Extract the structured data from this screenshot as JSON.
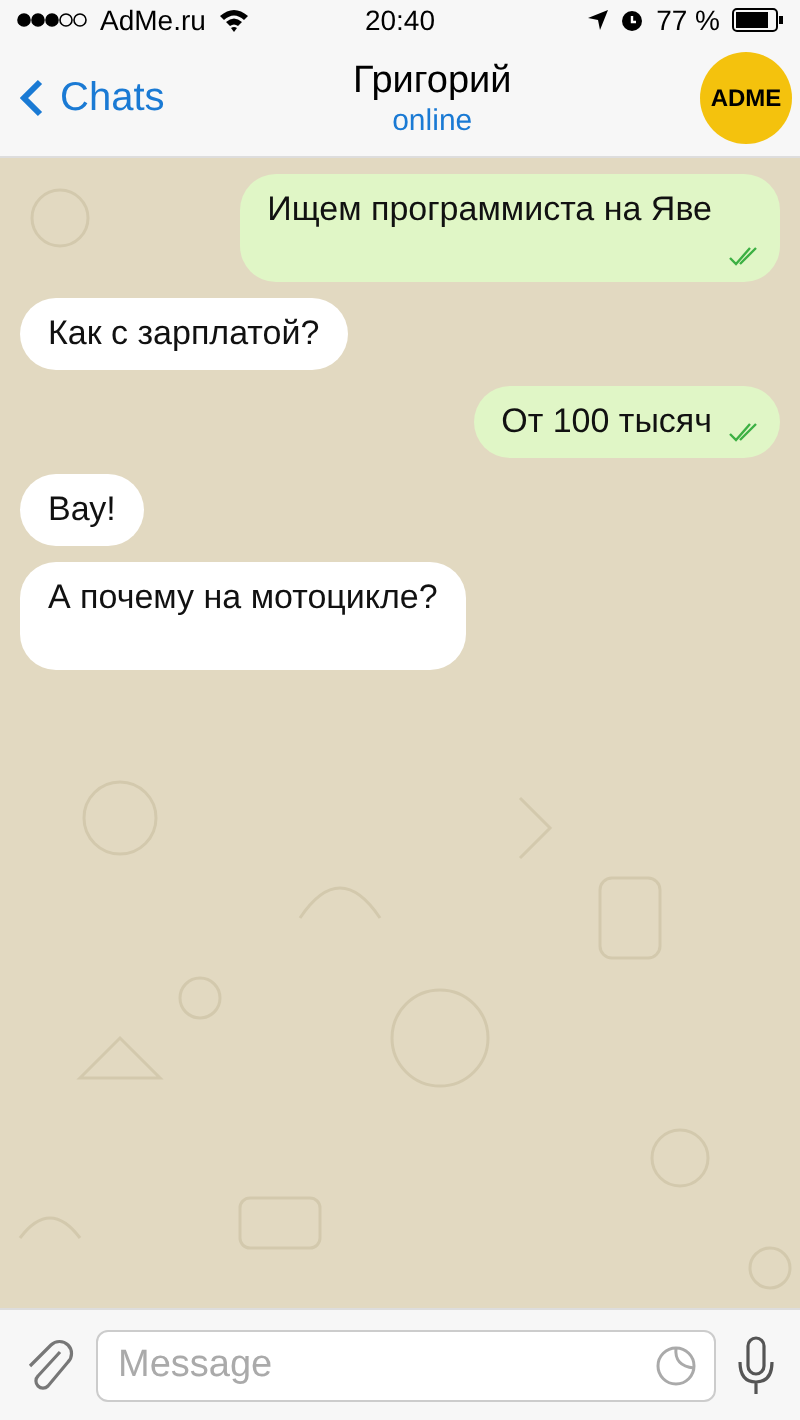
{
  "status_bar": {
    "carrier": "AdMe.ru",
    "time": "20:40",
    "battery": "77 %"
  },
  "header": {
    "back": "Chats",
    "title": "Григорий",
    "subtitle": "online",
    "avatar": "ADME"
  },
  "messages": [
    {
      "kind": "out",
      "text": "Ищем программиста на Яве",
      "read": true,
      "tall": true
    },
    {
      "kind": "in",
      "text": "Как с зарплатой?",
      "tall": false
    },
    {
      "kind": "out",
      "text": "От 100 тысяч",
      "read": true,
      "tall": false
    },
    {
      "kind": "in",
      "text": "Вау!",
      "tall": false
    },
    {
      "kind": "in",
      "text": "А почему на мотоцикле?",
      "tall": true
    }
  ],
  "composer": {
    "placeholder": "Message"
  }
}
